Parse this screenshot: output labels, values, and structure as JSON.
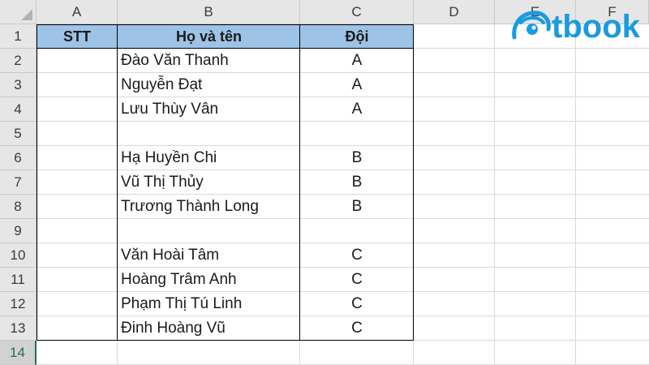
{
  "columns": [
    "A",
    "B",
    "C",
    "D",
    "E",
    "F"
  ],
  "rows": [
    "1",
    "2",
    "3",
    "4",
    "5",
    "6",
    "7",
    "8",
    "9",
    "10",
    "11",
    "12",
    "13",
    "14"
  ],
  "selected_row": "14",
  "table": {
    "headers": {
      "stt": "STT",
      "name": "Họ và tên",
      "team": "Đội"
    },
    "records": [
      {
        "name": "Đào Văn Thanh",
        "team": "A"
      },
      {
        "name": "Nguyễn Đạt",
        "team": "A"
      },
      {
        "name": "Lưu Thùy Vân",
        "team": "A"
      },
      {
        "name": "",
        "team": ""
      },
      {
        "name": "Hạ Huyền Chi",
        "team": "B"
      },
      {
        "name": "Vũ Thị Thủy",
        "team": "B"
      },
      {
        "name": "Trương Thành Long",
        "team": "B"
      },
      {
        "name": "",
        "team": ""
      },
      {
        "name": "Văn Hoài Tâm",
        "team": "C"
      },
      {
        "name": "Hoàng Trâm Anh",
        "team": "C"
      },
      {
        "name": "Phạm Thị Tú Linh",
        "team": "C"
      },
      {
        "name": "Đinh Hoàng Vũ",
        "team": "C"
      }
    ]
  },
  "colors": {
    "header_fill": "#9dc3e6",
    "brand": "#1a9ae0",
    "selection": "#217346"
  }
}
